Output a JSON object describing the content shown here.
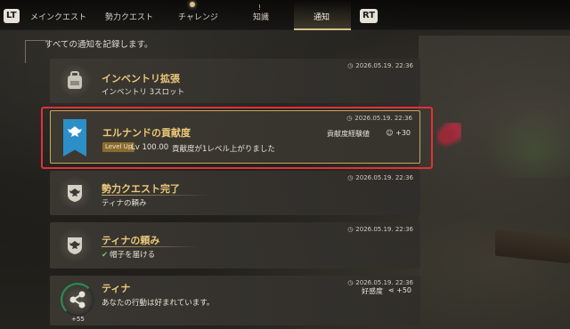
{
  "nav": {
    "left_button": "LT",
    "right_button": "RT",
    "tabs": [
      {
        "label": "メインクエスト"
      },
      {
        "label": "勢力クエスト"
      },
      {
        "label": "チャレンジ"
      },
      {
        "label": "知識"
      },
      {
        "label": "通知",
        "active": true
      }
    ]
  },
  "subtitle": "すべての通知を記録します。",
  "notifications": [
    {
      "title": "インベントリ拡張",
      "desc": "インベントリ 3スロット",
      "time": "2026.05.19. 22:36",
      "icon": "backpack-icon"
    },
    {
      "title": "エルナンドの貢献度",
      "desc": "貢献度が1レベル上がりました",
      "time": "2026.05.19. 22:36",
      "level_badge": "Level Up",
      "level_text": "Lv 100.00",
      "stat_label": "貢献度経験値",
      "stat_value": "+30",
      "icon": "eagle-banner-icon",
      "highlighted": true
    },
    {
      "title": "勢力クエスト完了",
      "desc": "ティナの頼み",
      "time": "2026.05.19. 22:36",
      "icon": "eagle-crest-icon"
    },
    {
      "title": "ティナの頼み",
      "desc": "帽子を届ける",
      "time": "2026.05.19. 22:36",
      "icon": "eagle-crest-icon",
      "checked": true
    },
    {
      "title": "ティナ",
      "desc": "あなたの行動は好まれています。",
      "time": "2026.05.19. 22:36",
      "stat_label": "好感度",
      "stat_value": "+50",
      "ring_value": "+55",
      "icon": "share-node-icon"
    }
  ],
  "colors": {
    "title_gold": "#ecc87a",
    "highlight_border": "#e0313a",
    "banner_blue": "#2d8fc7",
    "progress_green": "#2c8c53"
  }
}
